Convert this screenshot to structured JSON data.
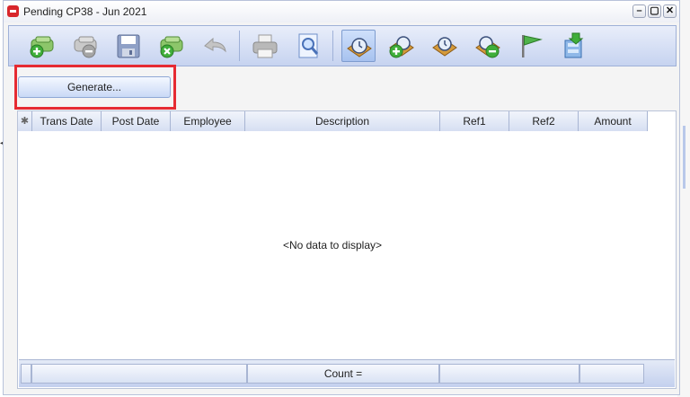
{
  "window": {
    "title": "Pending CP38 - Jun 2021"
  },
  "window_controls": {
    "minimize": "–",
    "maximize": "▢",
    "close": "✕"
  },
  "left_glyph": "◂",
  "toolbar": {
    "buttons": [
      {
        "icon": "add-record-icon",
        "state": "enabled"
      },
      {
        "icon": "delete-record-icon",
        "state": "disabled"
      },
      {
        "icon": "save-icon",
        "state": "disabled"
      },
      {
        "icon": "cancel-edit-icon",
        "state": "enabled"
      },
      {
        "icon": "undo-icon",
        "state": "disabled"
      },
      {
        "icon": "print-icon",
        "state": "disabled"
      },
      {
        "icon": "print-preview-icon",
        "state": "enabled"
      },
      {
        "icon": "history-icon",
        "state": "pressed"
      },
      {
        "icon": "add-history-icon",
        "state": "enabled"
      },
      {
        "icon": "history-info-icon",
        "state": "enabled"
      },
      {
        "icon": "remove-history-icon",
        "state": "enabled"
      },
      {
        "icon": "flag-icon",
        "state": "enabled"
      },
      {
        "icon": "export-icon",
        "state": "enabled"
      }
    ]
  },
  "generate_button": {
    "label": "Generate..."
  },
  "grid": {
    "columns": [
      "✱",
      "Trans Date",
      "Post Date",
      "Employee",
      "Description",
      "Ref1",
      "Ref2",
      "Amount"
    ],
    "empty_message": "<No data to display>",
    "footer": {
      "count_label": "Count ="
    }
  }
}
